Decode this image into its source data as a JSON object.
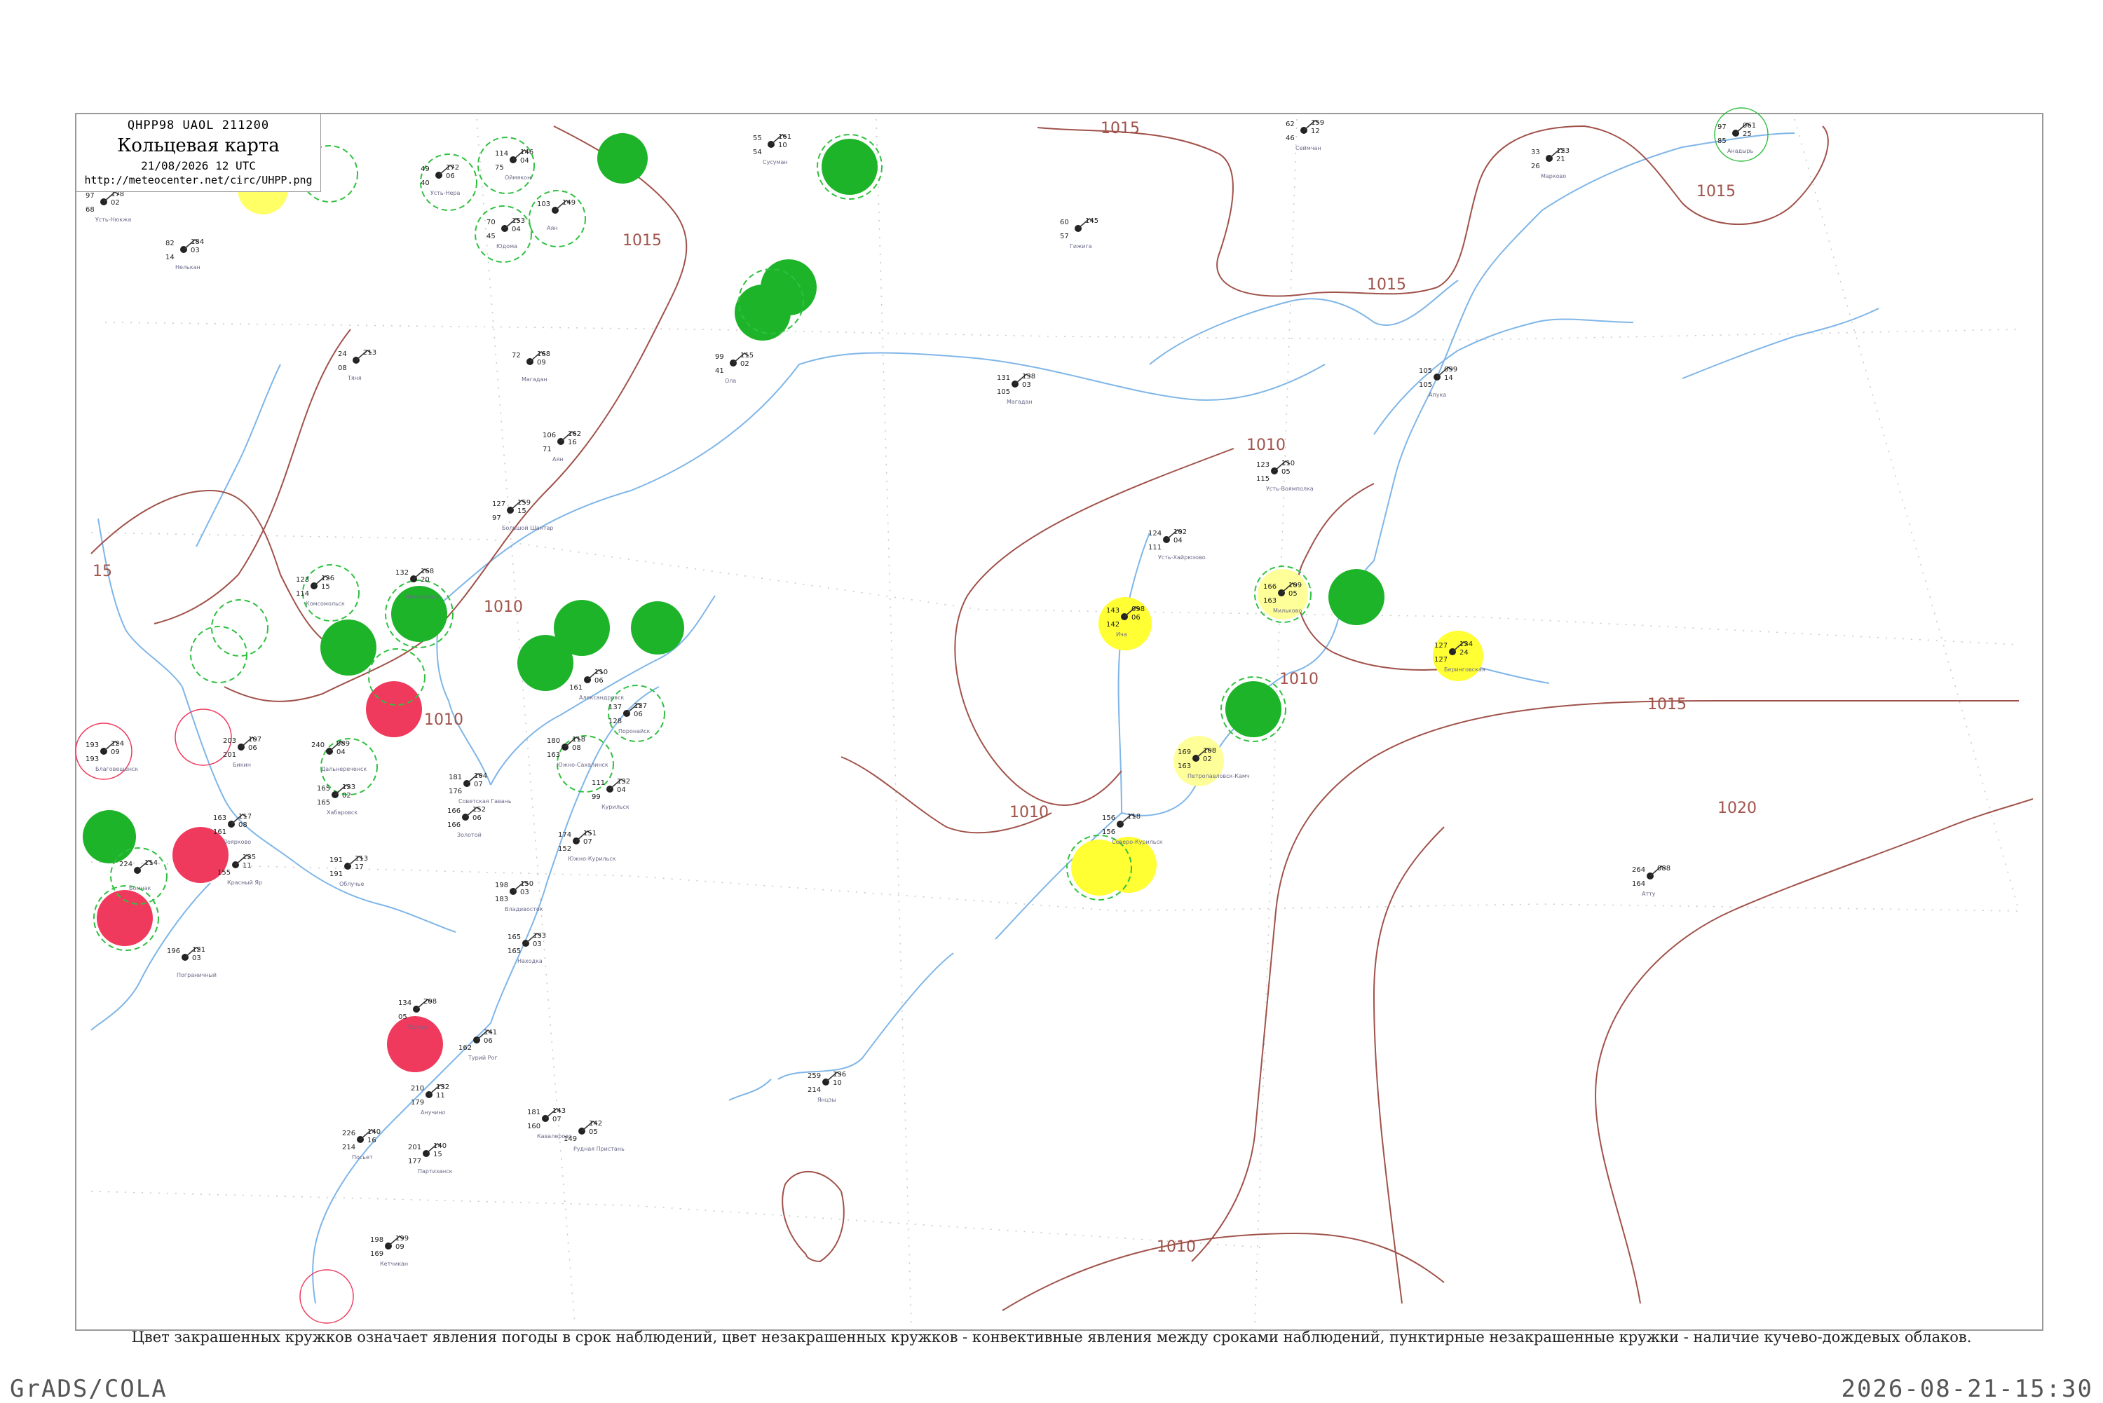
{
  "header": {
    "code": "QHPP98  UAOL  211200",
    "title": "Кольцевая карта",
    "date": "21/08/2026 12 UTC",
    "url": "http://meteocenter.net/circ/UHPP.png"
  },
  "footer": {
    "note": "Цвет закрашенных кружков означает явления погоды в срок наблюдений, цвет незакрашенных кружков - конвективные явления между сроками наблюдений, пунктирные незакрашенные кружки - наличие кучево-дождевых облаков.",
    "software": "GrADS/COLA",
    "timestamp": "2026-08-21-15:30"
  },
  "colors": {
    "isobar": "#a0524a",
    "river": "#7fb6e8",
    "green_fill": "#1db42a",
    "yellow_fill": "#ffff33",
    "red_fill": "#ef3a5d",
    "frame": "#999999"
  },
  "isobars": [
    {
      "label": "1015"
    },
    {
      "label": "1015"
    },
    {
      "label": "1015"
    },
    {
      "label": "1010"
    },
    {
      "label": "1010"
    },
    {
      "label": "1010"
    },
    {
      "label": "1010"
    },
    {
      "label": "1010"
    },
    {
      "label": "1015"
    },
    {
      "label": "1020"
    },
    {
      "label": "1010"
    },
    {
      "label": "15"
    }
  ],
  "stations": [
    {
      "a": "178",
      "b": "02",
      "c": "97",
      "d": "68",
      "name": "Усть-Нюкжа"
    },
    {
      "a": "185",
      "b": "04",
      "c": "84",
      "d": "94",
      "name": "Хара"
    },
    {
      "a": "172",
      "b": "06",
      "c": "49",
      "d": "40",
      "name": "Усть-Нера"
    },
    {
      "a": "146",
      "b": "04",
      "c": "114",
      "d": "75",
      "name": "Оймякон"
    },
    {
      "a": "184",
      "b": "03",
      "c": "82",
      "d": "14",
      "name": "Нелькан"
    },
    {
      "a": "153",
      "b": "04",
      "c": "70",
      "d": "45",
      "name": "Юдома"
    },
    {
      "a": "149",
      "b": "",
      "c": "103",
      "d": "",
      "name": "Аян"
    },
    {
      "a": "161",
      "b": "10",
      "c": "55",
      "d": "54",
      "name": "Сусуман"
    },
    {
      "a": "159",
      "b": "12",
      "c": "62",
      "d": "46",
      "name": "Сеймчан"
    },
    {
      "a": "123",
      "b": "21",
      "c": "33",
      "d": "26",
      "name": "Марково"
    },
    {
      "a": "061",
      "b": "25",
      "c": "97",
      "d": "85",
      "name": "Анадырь"
    },
    {
      "a": "145",
      "b": "",
      "c": "60",
      "d": "57",
      "name": "Гижига"
    },
    {
      "a": "168",
      "b": "09",
      "c": "72",
      "d": "",
      "name": "Магадан"
    },
    {
      "a": "213",
      "b": "",
      "c": "24",
      "d": "08",
      "name": "Тяня"
    },
    {
      "a": "115",
      "b": "02",
      "c": "99",
      "d": "41",
      "name": "Ола"
    },
    {
      "a": "138",
      "b": "03",
      "c": "131",
      "d": "105",
      "name": "Магадан"
    },
    {
      "a": "099",
      "b": "14",
      "c": "105",
      "d": "105",
      "name": "Апука"
    },
    {
      "a": "110",
      "b": "05",
      "c": "123",
      "d": "115",
      "name": "Усть-Воямполка"
    },
    {
      "a": "102",
      "b": "04",
      "c": "124",
      "d": "111",
      "name": "Усть-Хайрюзово"
    },
    {
      "a": "098",
      "b": "06",
      "c": "143",
      "d": "142",
      "name": "Ича"
    },
    {
      "a": "109",
      "b": "05",
      "c": "166",
      "d": "163",
      "name": "Мильково"
    },
    {
      "a": "124",
      "b": "24",
      "c": "127",
      "d": "127",
      "name": "Беринговская"
    },
    {
      "a": "108",
      "b": "02",
      "c": "169",
      "d": "163",
      "name": "Петропавловск-Камч"
    },
    {
      "a": "118",
      "b": "",
      "c": "156",
      "d": "156",
      "name": "Северо-Курильск"
    },
    {
      "a": "088",
      "b": "",
      "c": "264",
      "d": "164",
      "name": "Атту"
    },
    {
      "a": "162",
      "b": "16",
      "c": "106",
      "d": "71",
      "name": "Аян"
    },
    {
      "a": "159",
      "b": "15",
      "c": "127",
      "d": "97",
      "name": "Большой Шантар"
    },
    {
      "a": "168",
      "b": "20",
      "c": "132",
      "d": "",
      "name": "Николаевск"
    },
    {
      "a": "126",
      "b": "15",
      "c": "123",
      "d": "114",
      "name": "Комсомольск"
    },
    {
      "a": "110",
      "b": "06",
      "c": "",
      "d": "161",
      "name": "Александровск"
    },
    {
      "a": "127",
      "b": "06",
      "c": "137",
      "d": "128",
      "name": "Поронайск"
    },
    {
      "a": "118",
      "b": "08",
      "c": "180",
      "d": "163",
      "name": "Южно-Сахалинск"
    },
    {
      "a": "132",
      "b": "04",
      "c": "111",
      "d": "99",
      "name": "Курильск"
    },
    {
      "a": "151",
      "b": "07",
      "c": "174",
      "d": "152",
      "name": "Южно-Курильск"
    },
    {
      "a": "104",
      "b": "07",
      "c": "181",
      "d": "176",
      "name": "Советская Гавань"
    },
    {
      "a": "152",
      "b": "06",
      "c": "166",
      "d": "166",
      "name": "Золотой"
    },
    {
      "a": "150",
      "b": "03",
      "c": "198",
      "d": "183",
      "name": "Владивосток"
    },
    {
      "a": "133",
      "b": "03",
      "c": "165",
      "d": "165",
      "name": "Находка"
    },
    {
      "a": "089",
      "b": "04",
      "c": "240",
      "d": "",
      "name": "Дальнереченск"
    },
    {
      "a": "123",
      "b": "02",
      "c": "165",
      "d": "165",
      "name": "Хабаровск"
    },
    {
      "a": "107",
      "b": "06",
      "c": "203",
      "d": "201",
      "name": "Бикин"
    },
    {
      "a": "124",
      "b": "09",
      "c": "193",
      "d": "193",
      "name": "Благовещенск"
    },
    {
      "a": "117",
      "b": "08",
      "c": "163",
      "d": "161",
      "name": "Поярково"
    },
    {
      "a": "113",
      "b": "17",
      "c": "191",
      "d": "191",
      "name": "Облучье"
    },
    {
      "a": "114",
      "b": "",
      "c": "224",
      "d": "",
      "name": "Бомнак"
    },
    {
      "a": "125",
      "b": "11",
      "c": "",
      "d": "155",
      "name": "Красный Яр"
    },
    {
      "a": "121",
      "b": "03",
      "c": "196",
      "d": "",
      "name": "Пограничный"
    },
    {
      "a": "208",
      "b": "",
      "c": "134",
      "d": "05",
      "name": "Ушмун"
    },
    {
      "a": "141",
      "b": "06",
      "c": "",
      "d": "162",
      "name": "Турий Рог"
    },
    {
      "a": "132",
      "b": "11",
      "c": "210",
      "d": "179",
      "name": "Анучино"
    },
    {
      "a": "143",
      "b": "07",
      "c": "181",
      "d": "160",
      "name": "Кавалерово"
    },
    {
      "a": "142",
      "b": "05",
      "c": "",
      "d": "149",
      "name": "Рудная Пристань"
    },
    {
      "a": "140",
      "b": "16",
      "c": "226",
      "d": "214",
      "name": "Посьет"
    },
    {
      "a": "140",
      "b": "15",
      "c": "201",
      "d": "177",
      "name": "Партизанск"
    },
    {
      "a": "199",
      "b": "09",
      "c": "198",
      "d": "169",
      "name": "Кетчикан"
    },
    {
      "a": "136",
      "b": "10",
      "c": "259",
      "d": "214",
      "name": "Янцзы"
    }
  ]
}
